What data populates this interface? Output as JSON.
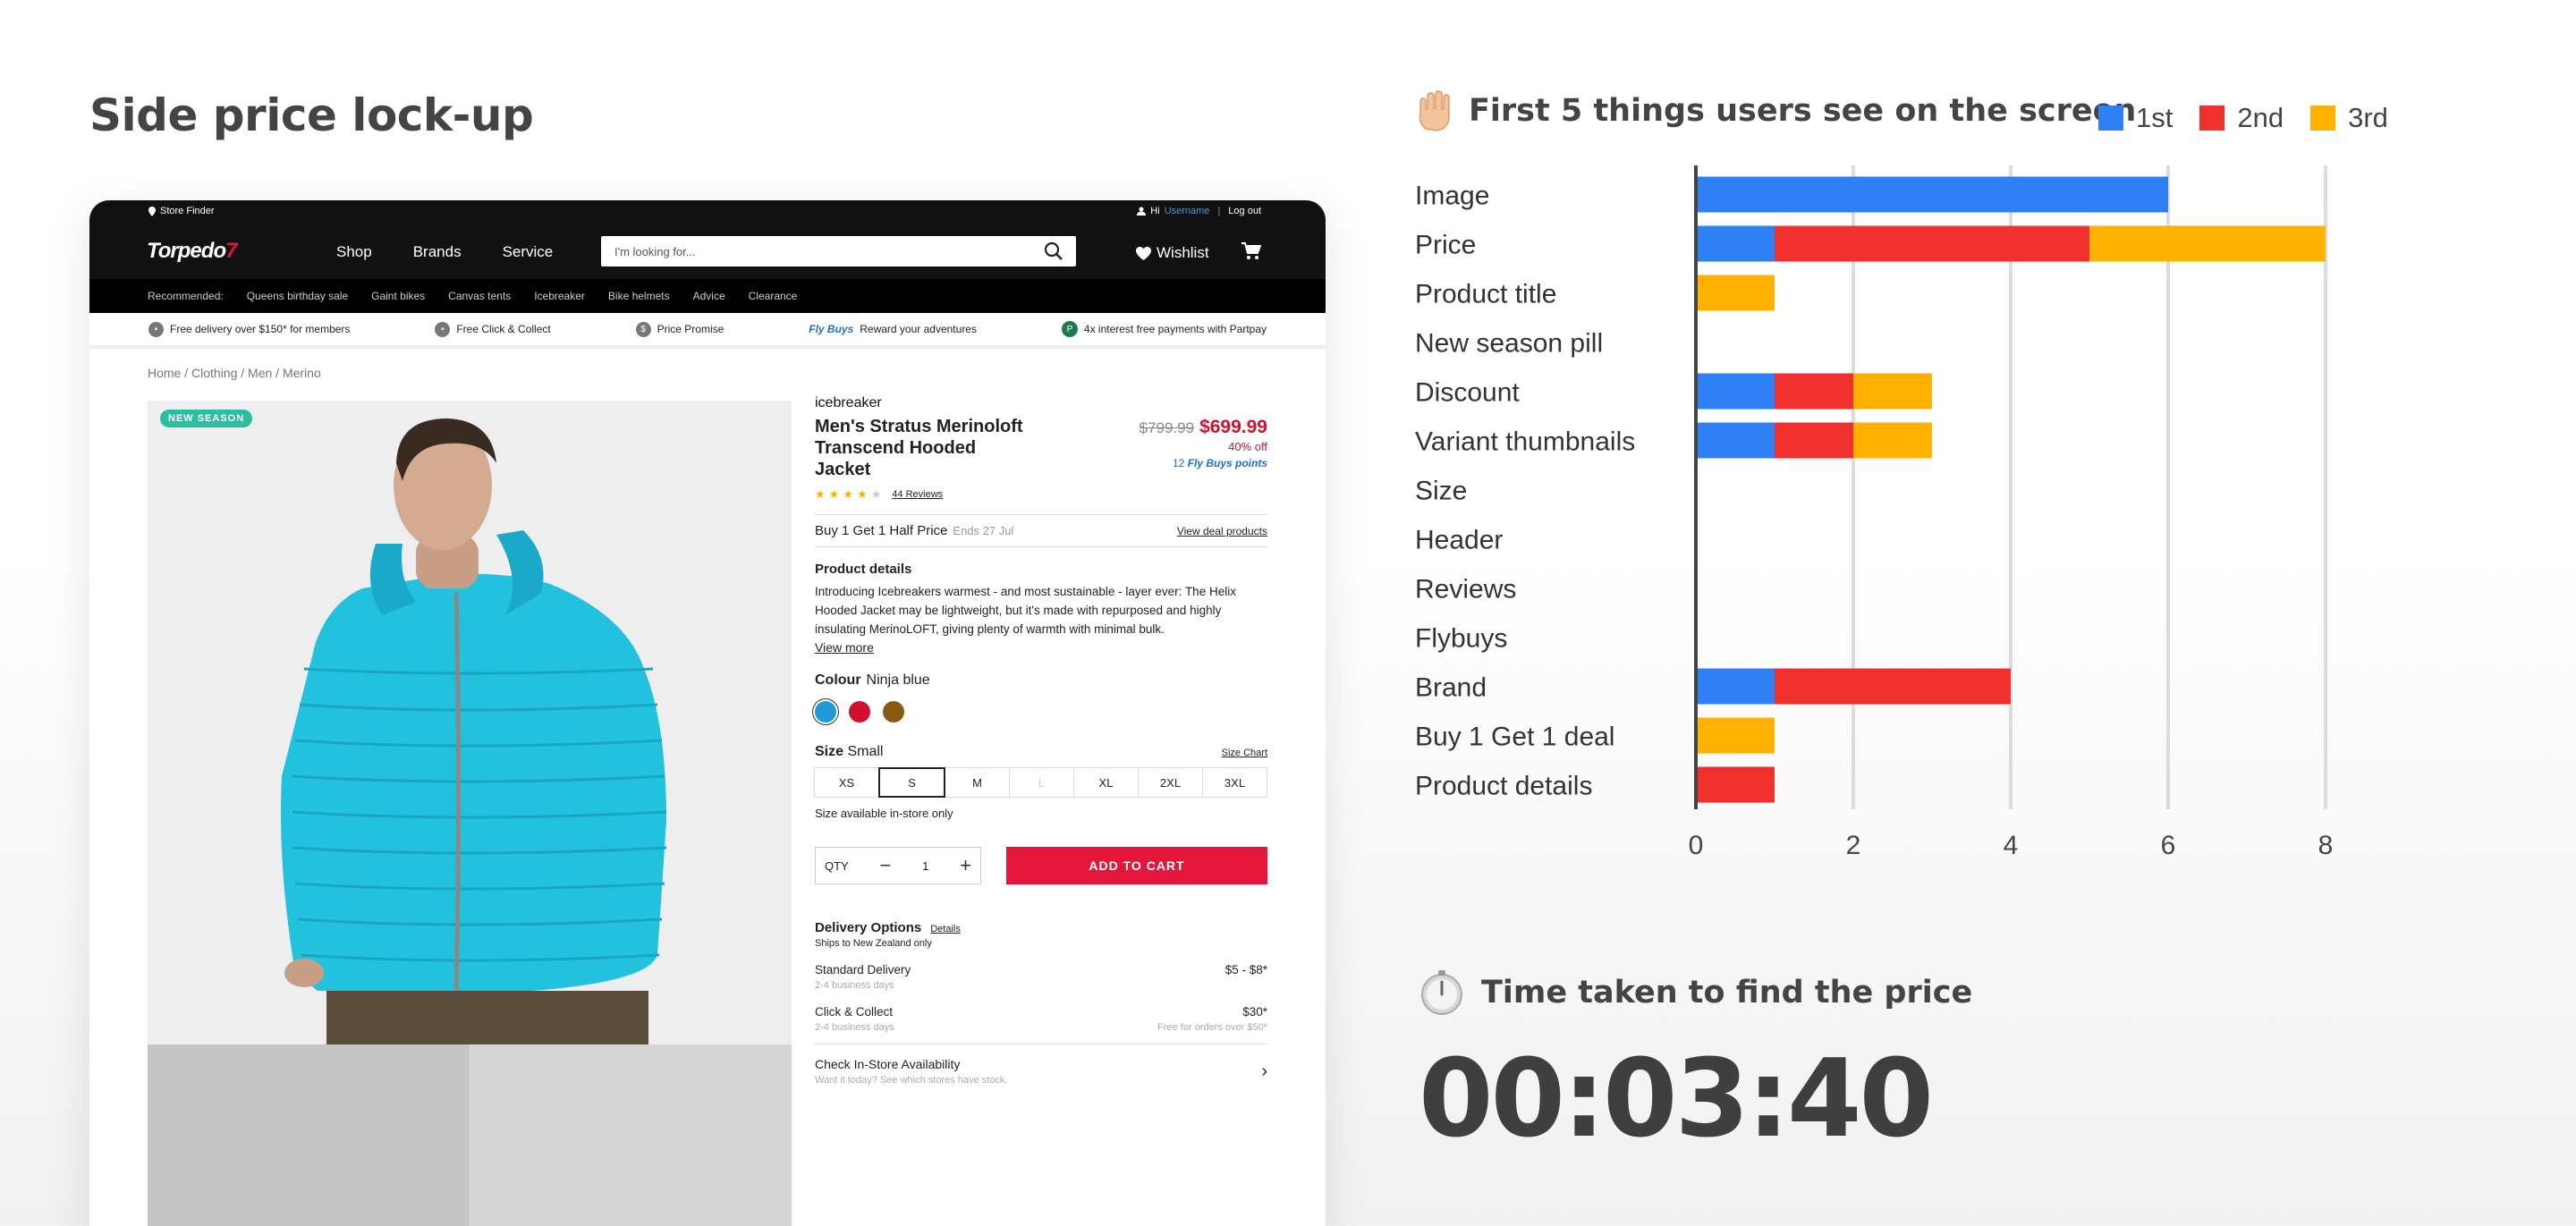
{
  "page_title": "Side price lock-up",
  "site": {
    "utility": {
      "store_finder": "Store Finder",
      "greeting": "Hi",
      "username": "Username",
      "logout": "Log out"
    },
    "logo": {
      "text": "Torpedo",
      "mark": "7"
    },
    "nav": [
      "Shop",
      "Brands",
      "Service"
    ],
    "search_placeholder": "I'm looking for...",
    "wishlist": "Wishlist",
    "recommended_label": "Recommended:",
    "recommended": [
      "Queens birthday sale",
      "Gaint bikes",
      "Canvas tents",
      "Icebreaker",
      "Bike helmets",
      "Advice",
      "Clearance"
    ],
    "usps": {
      "delivery": "Free delivery over $150* for members",
      "click_collect": "Free Click & Collect",
      "price_promise": "Price Promise",
      "flybuys_logo": "Fly Buys",
      "flybuys_text": "Reward your adventures",
      "partpay": "4x interest free payments with Partpay"
    },
    "breadcrumb": "Home / Clothing / Men / Merino",
    "pill": "NEW SEASON"
  },
  "product": {
    "brand": "icebreaker",
    "title": "Men's Stratus Merinoloft Transcend Hooded Jacket",
    "reviews": "44 Reviews",
    "rating": 4.5,
    "was_price": "$799.99",
    "price": "$699.99",
    "discount": "40% off",
    "points": "12",
    "points_label": "Fly Buys points",
    "deal": "Buy 1 Get 1 Half Price",
    "deal_ends": "Ends 27 Jul",
    "view_deal": "View deal products",
    "details_heading": "Product details",
    "details_text": "Introducing Icebreakers warmest - and most sustainable - layer ever: The Helix Hooded Jacket may be lightweight, but it's made with repurposed and highly insulating MerinoLOFT, giving plenty of warmth with minimal bulk.",
    "view_more": "View more",
    "colour_label": "Colour",
    "colour_value": "Ninja blue",
    "swatches": [
      "#1f9ad6",
      "#d1102e",
      "#8a5a12"
    ],
    "size_label": "Size",
    "size_value": "Small",
    "size_chart": "Size Chart",
    "sizes": [
      "XS",
      "S",
      "M",
      "L",
      "XL",
      "2XL",
      "3XL"
    ],
    "size_note": "Size available in-store only",
    "qty_label": "QTY",
    "qty": "1",
    "add_to_cart": "ADD TO CART",
    "delivery_heading": "Delivery Options",
    "delivery_details": "Details",
    "delivery_note": "Ships to New Zealand only",
    "standard_name": "Standard Delivery",
    "standard_days": "2-4 business days",
    "standard_price": "$5 - $8*",
    "cc_name": "Click & Collect",
    "cc_days": "2-4 business days",
    "cc_price": "$30*",
    "cc_note": "Free for orders over $50*",
    "check_store": "Check In-Store Availability",
    "check_store_sub": "Want it today? See which stores have stock."
  },
  "chart_heading": "First 5 things users see on the screen",
  "legend": [
    {
      "name": "1st",
      "color": "#2f7ff5"
    },
    {
      "name": "2nd",
      "color": "#f0302e"
    },
    {
      "name": "3rd",
      "color": "#ffb000"
    }
  ],
  "chart_data": {
    "type": "bar",
    "orientation": "horizontal",
    "stacked": true,
    "categories": [
      "Image",
      "Price",
      "Product title",
      "New season pill",
      "Discount",
      "Variant thumbnails",
      "Size",
      "Header",
      "Reviews",
      "Flybuys",
      "Brand",
      "Buy 1 Get 1 deal",
      "Product details"
    ],
    "series": [
      {
        "name": "1st",
        "color": "#2f7ff5",
        "values": [
          6,
          1,
          0,
          0,
          1,
          1,
          0,
          0,
          0,
          0,
          1,
          0,
          0
        ]
      },
      {
        "name": "2nd",
        "color": "#f0302e",
        "values": [
          0,
          4,
          0,
          0,
          1,
          1,
          0,
          0,
          0,
          0,
          3,
          0,
          1
        ]
      },
      {
        "name": "3rd",
        "color": "#ffb000",
        "values": [
          0,
          3,
          1,
          0,
          1,
          1,
          0,
          0,
          0,
          0,
          0,
          1,
          0
        ]
      }
    ],
    "xlim": [
      0,
      8
    ],
    "xticks": [
      "0",
      "2",
      "4",
      "6",
      "8"
    ],
    "grid": true,
    "legend_position": "top-right"
  },
  "time_label": "Time taken to find the price",
  "time_value": "00:03:40"
}
